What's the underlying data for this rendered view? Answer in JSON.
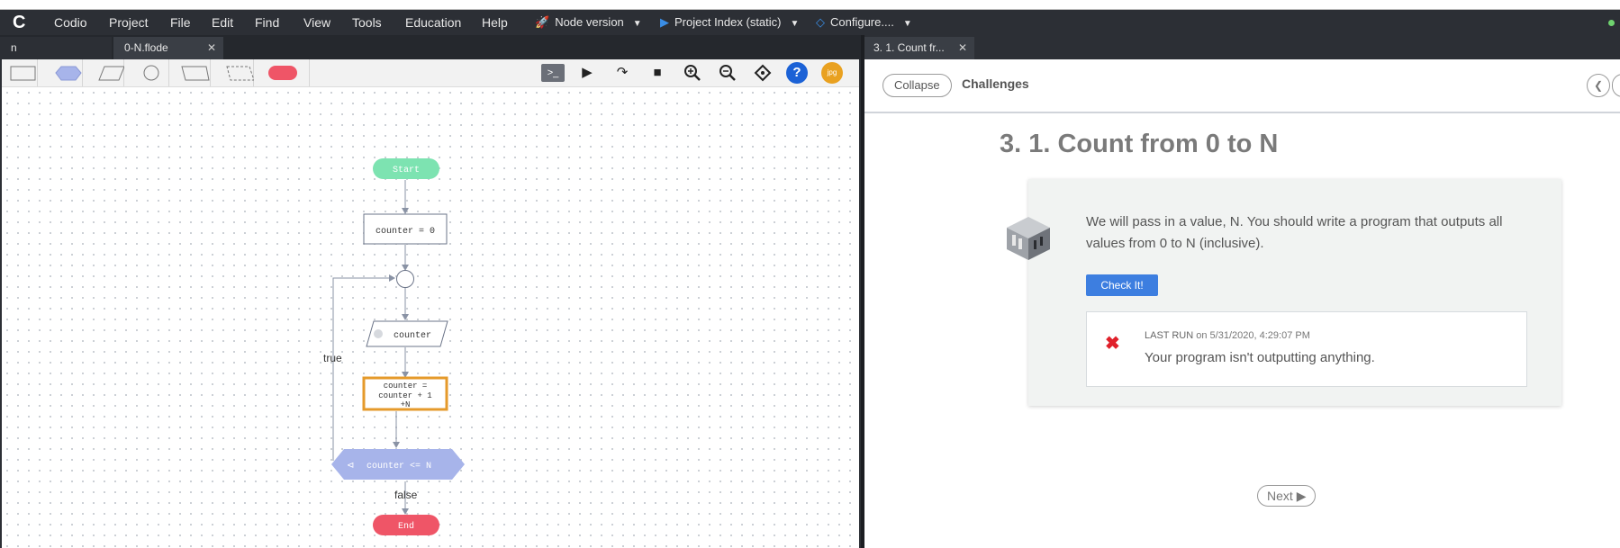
{
  "menubar": {
    "logo": "C",
    "items": [
      "Codio",
      "Project",
      "File",
      "Edit",
      "Find",
      "View",
      "Tools",
      "Education",
      "Help"
    ],
    "tools": [
      "Node version",
      "Project Index (static)",
      "Configure...."
    ]
  },
  "left_tabs": [
    "n",
    "0-N.flode"
  ],
  "toolbar": {
    "image_button": "jpg",
    "help_glyph": "?"
  },
  "flowchart": {
    "start": "Start",
    "init": "counter = 0",
    "output": "counter",
    "process": [
      "counter =",
      "counter + 1",
      "+N"
    ],
    "decision": "counter <= N",
    "true_label": "true",
    "false_label": "false",
    "end": "End"
  },
  "right_tab": "3. 1. Count fr...",
  "guide": {
    "collapse": "Collapse",
    "challenges": "Challenges",
    "prev_glyph": "❮",
    "title": "3. 1. Count from 0 to N",
    "description": "We will pass in a value, N. You should write a program that outputs all values from 0 to N (inclusive).",
    "check": "Check It!",
    "last_run_label": "LAST RUN",
    "last_run_time": "on 5/31/2020, 4:29:07 PM",
    "result": "Your program isn't outputting anything.",
    "next": "Next"
  },
  "colors": {
    "menubar": "#2c2f35",
    "start_node": "#7de3b1",
    "end_node": "#ef5567",
    "decision": "#a7b4ea",
    "selected_border": "#e59a2b",
    "check_button": "#3d7ee0",
    "fail": "#e0202a"
  }
}
